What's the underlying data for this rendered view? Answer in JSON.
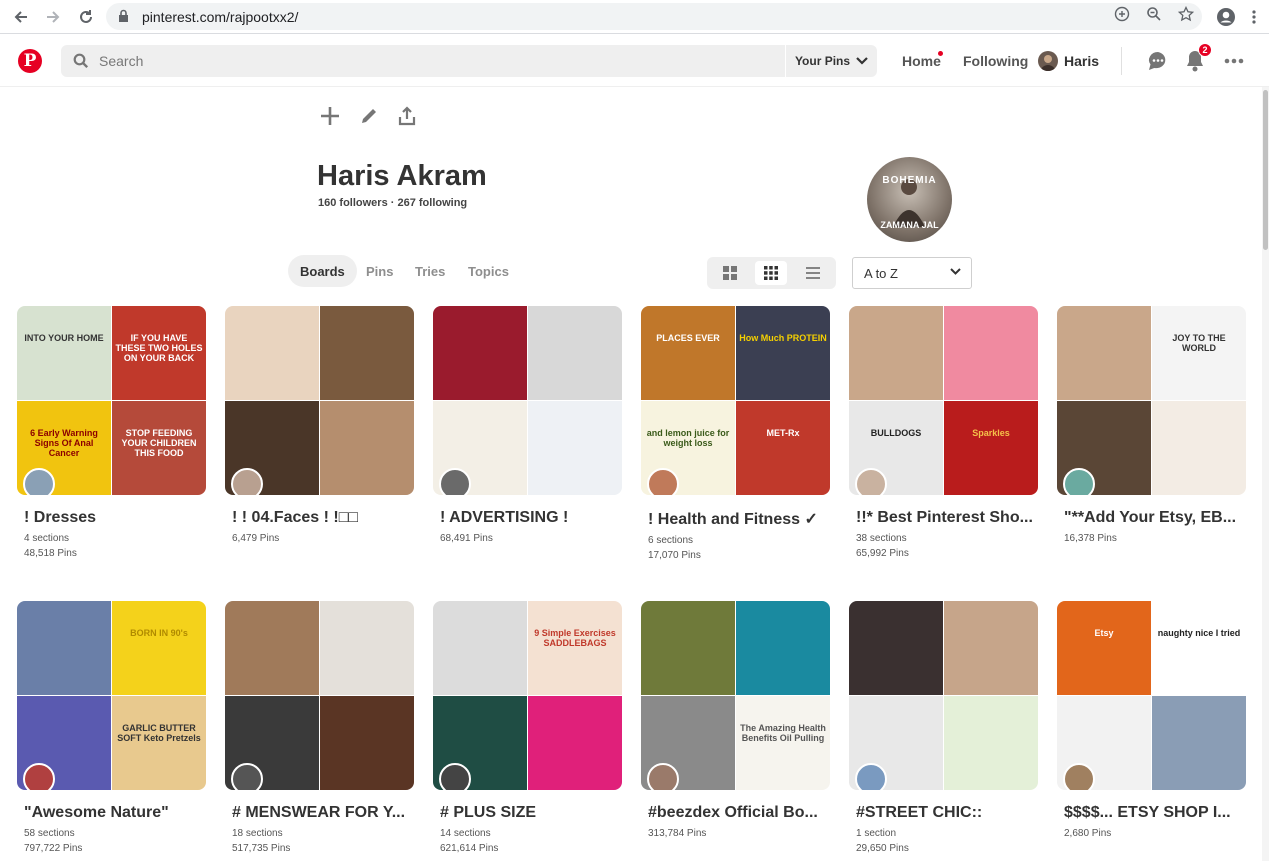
{
  "browser": {
    "url": "pinterest.com/rajpootxx2/",
    "icons": [
      "back-arrow-icon",
      "forward-arrow-icon",
      "reload-icon",
      "lock-icon",
      "add-icon",
      "zoom-icon",
      "star-icon",
      "account-icon",
      "menu-icon"
    ]
  },
  "header": {
    "search_placeholder": "Search",
    "your_pins": "Your Pins",
    "home": "Home",
    "following": "Following",
    "user": "Haris",
    "notifications_count": "2",
    "brand_color": "#e60023"
  },
  "profile": {
    "name": "Haris Akram",
    "stats": "160 followers · 267 following",
    "avatar_text_top": "BOHEMIA",
    "avatar_text_bottom": "ZAMANA JAL"
  },
  "tabs": [
    "Boards",
    "Pins",
    "Tries",
    "Topics"
  ],
  "active_tab": "Boards",
  "sort": "A to Z",
  "boards": [
    {
      "title": "! Dresses",
      "sections": "4 sections",
      "pins": "48,518 Pins",
      "tiles": [
        {
          "bg": "#d7e2d0",
          "cap": "INTO YOUR HOME",
          "col": "#333"
        },
        {
          "bg": "#c0392b",
          "cap": "IF YOU HAVE THESE TWO HOLES ON YOUR BACK",
          "col": "#fff"
        },
        {
          "bg": "#f1c40f",
          "cap": "6 Early Warning Signs Of Anal Cancer",
          "col": "#8b0000"
        },
        {
          "bg": "#b54a3a",
          "cap": "STOP FEEDING YOUR CHILDREN THIS FOOD",
          "col": "#fff"
        }
      ]
    },
    {
      "title": "! ! 04.Faces ! !□□",
      "sections": "",
      "pins": "6,479 Pins",
      "tiles": [
        {
          "bg": "#e9d4bf",
          "cap": "",
          "col": "#333"
        },
        {
          "bg": "#7a5a3e",
          "cap": "",
          "col": "#fff"
        },
        {
          "bg": "#4a3628",
          "cap": "",
          "col": "#fff"
        },
        {
          "bg": "#b58e6e",
          "cap": "",
          "col": "#fff"
        }
      ]
    },
    {
      "title": "! ADVERTISING !",
      "sections": "",
      "pins": "68,491 Pins",
      "tiles": [
        {
          "bg": "#9a1b2d",
          "cap": "",
          "col": "#fff"
        },
        {
          "bg": "#d8d8d8",
          "cap": "",
          "col": "#333"
        },
        {
          "bg": "#f3efe6",
          "cap": "",
          "col": "#333"
        },
        {
          "bg": "#eef1f5",
          "cap": "",
          "col": "#333"
        }
      ]
    },
    {
      "title": "! Health and Fitness ✓",
      "sections": "6 sections",
      "pins": "17,070 Pins",
      "tiles": [
        {
          "bg": "#c0772a",
          "cap": "PLACES EVER",
          "col": "#fff"
        },
        {
          "bg": "#3b3f52",
          "cap": "How Much PROTEIN",
          "col": "#f5d000"
        },
        {
          "bg": "#f7f3df",
          "cap": "and lemon juice for weight loss",
          "col": "#3a5a1a"
        },
        {
          "bg": "#c0392b",
          "cap": "MET-Rx",
          "col": "#fff"
        }
      ]
    },
    {
      "title": "!!* Best Pinterest Sho...",
      "sections": "38 sections",
      "pins": "65,992 Pins",
      "tiles": [
        {
          "bg": "#c9a78a",
          "cap": "",
          "col": "#333"
        },
        {
          "bg": "#f08aa0",
          "cap": "",
          "col": "#fff"
        },
        {
          "bg": "#e8e8e8",
          "cap": "BULLDOGS",
          "col": "#222"
        },
        {
          "bg": "#b91c1c",
          "cap": "Sparkles",
          "col": "#f5c04a"
        }
      ]
    },
    {
      "title": "\"**Add Your Etsy, EB...",
      "sections": "",
      "pins": "16,378 Pins",
      "tiles": [
        {
          "bg": "#c9a78a",
          "cap": "",
          "col": "#333"
        },
        {
          "bg": "#f4f4f4",
          "cap": "JOY TO THE WORLD",
          "col": "#333"
        },
        {
          "bg": "#5a4636",
          "cap": "",
          "col": "#fff"
        },
        {
          "bg": "#f3ece4",
          "cap": "",
          "col": "#333"
        }
      ]
    },
    {
      "title": "\"Awesome Nature\"",
      "sections": "58 sections",
      "pins": "797,722 Pins",
      "tiles": [
        {
          "bg": "#6a7fa8",
          "cap": "",
          "col": "#fff"
        },
        {
          "bg": "#f4d21b",
          "cap": "BORN IN 90's",
          "col": "#b08a00"
        },
        {
          "bg": "#5a5ab0",
          "cap": "",
          "col": "#fff"
        },
        {
          "bg": "#e8c98e",
          "cap": "GARLIC BUTTER SOFT Keto Pretzels",
          "col": "#333"
        }
      ]
    },
    {
      "title": "# MENSWEAR FOR Y...",
      "sections": "18 sections",
      "pins": "517,735 Pins",
      "tiles": [
        {
          "bg": "#a07a5a",
          "cap": "",
          "col": "#fff"
        },
        {
          "bg": "#e4e0da",
          "cap": "",
          "col": "#333"
        },
        {
          "bg": "#3a3a3a",
          "cap": "",
          "col": "#fff"
        },
        {
          "bg": "#5a3524",
          "cap": "",
          "col": "#fff"
        }
      ]
    },
    {
      "title": "# PLUS SIZE",
      "sections": "14 sections",
      "pins": "621,614 Pins",
      "tiles": [
        {
          "bg": "#dcdcdc",
          "cap": "",
          "col": "#333"
        },
        {
          "bg": "#f4e1d2",
          "cap": "9 Simple Exercises SADDLEBAGS",
          "col": "#c0392b"
        },
        {
          "bg": "#1f4d44",
          "cap": "",
          "col": "#fff"
        },
        {
          "bg": "#e0207a",
          "cap": "",
          "col": "#fff"
        }
      ]
    },
    {
      "title": "#beezdex Official Bo...",
      "sections": "",
      "pins": "313,784 Pins",
      "tiles": [
        {
          "bg": "#6f7a3a",
          "cap": "",
          "col": "#fff"
        },
        {
          "bg": "#1a8aa0",
          "cap": "",
          "col": "#fff"
        },
        {
          "bg": "#8a8a8a",
          "cap": "",
          "col": "#fff"
        },
        {
          "bg": "#f6f4ee",
          "cap": "The Amazing Health Benefits Oil Pulling",
          "col": "#555"
        }
      ]
    },
    {
      "title": "#STREET CHIC::",
      "sections": "1 section",
      "pins": "29,650 Pins",
      "tiles": [
        {
          "bg": "#3a3030",
          "cap": "",
          "col": "#fff"
        },
        {
          "bg": "#c6a58a",
          "cap": "",
          "col": "#333"
        },
        {
          "bg": "#e8e8e8",
          "cap": "",
          "col": "#333"
        },
        {
          "bg": "#e4f0d8",
          "cap": "",
          "col": "#333"
        }
      ]
    },
    {
      "title": "$$$$... ETSY SHOP I...",
      "sections": "",
      "pins": "2,680 Pins",
      "tiles": [
        {
          "bg": "#e2661b",
          "cap": "Etsy",
          "col": "#fff"
        },
        {
          "bg": "#ffffff",
          "cap": "naughty nice I tried",
          "col": "#222"
        },
        {
          "bg": "#f2f2f2",
          "cap": "",
          "col": "#333"
        },
        {
          "bg": "#8a9db5",
          "cap": "",
          "col": "#fff"
        }
      ]
    }
  ]
}
